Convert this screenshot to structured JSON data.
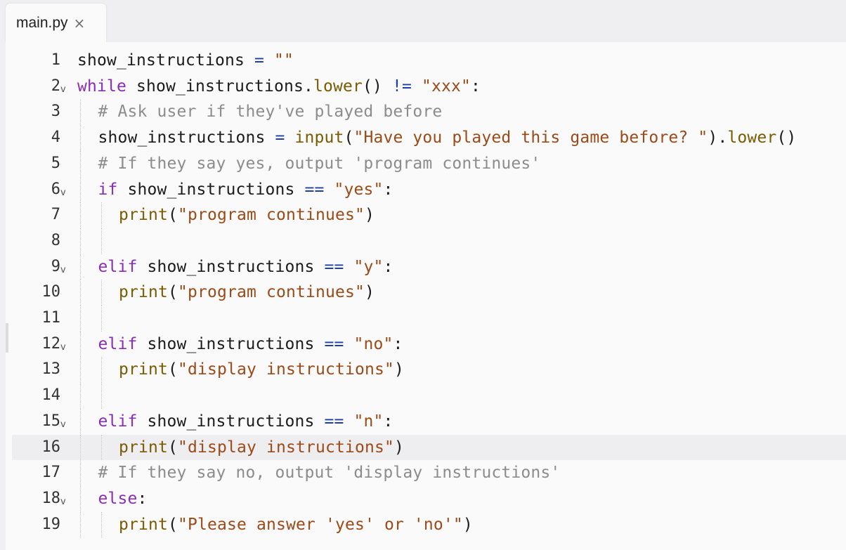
{
  "tab": {
    "filename": "main.py",
    "close_icon": "×"
  },
  "fold_glyph": "v",
  "active_line": 16,
  "lines": [
    {
      "n": "1",
      "fold": false,
      "indent": 0,
      "tokens": [
        [
          "t",
          "show_instructions"
        ],
        [
          "t",
          " "
        ],
        [
          "op",
          "="
        ],
        [
          "t",
          " "
        ],
        [
          "str",
          "\"\""
        ]
      ]
    },
    {
      "n": "2",
      "fold": true,
      "indent": 0,
      "tokens": [
        [
          "kw",
          "while"
        ],
        [
          "t",
          " show_instructions."
        ],
        [
          "fn",
          "lower"
        ],
        [
          "t",
          "() "
        ],
        [
          "op",
          "!="
        ],
        [
          "t",
          " "
        ],
        [
          "str",
          "\"xxx\""
        ],
        [
          "t",
          ":"
        ]
      ]
    },
    {
      "n": "3",
      "fold": false,
      "indent": 1,
      "tokens": [
        [
          "cmt",
          "# Ask user if they've played before"
        ]
      ]
    },
    {
      "n": "4",
      "fold": false,
      "indent": 1,
      "tokens": [
        [
          "t",
          "show_instructions "
        ],
        [
          "op",
          "="
        ],
        [
          "t",
          " "
        ],
        [
          "fn",
          "input"
        ],
        [
          "t",
          "("
        ],
        [
          "str",
          "\"Have you played this game before? \""
        ],
        [
          "t",
          ")."
        ],
        [
          "fn",
          "lower"
        ],
        [
          "t",
          "()"
        ]
      ]
    },
    {
      "n": "5",
      "fold": false,
      "indent": 1,
      "tokens": [
        [
          "cmt",
          "# If they say yes, output 'program continues'"
        ]
      ]
    },
    {
      "n": "6",
      "fold": true,
      "indent": 1,
      "tokens": [
        [
          "kw",
          "if"
        ],
        [
          "t",
          " show_instructions "
        ],
        [
          "op",
          "=="
        ],
        [
          "t",
          " "
        ],
        [
          "str",
          "\"yes\""
        ],
        [
          "t",
          ":"
        ]
      ]
    },
    {
      "n": "7",
      "fold": false,
      "indent": 2,
      "tokens": [
        [
          "fn",
          "print"
        ],
        [
          "t",
          "("
        ],
        [
          "str",
          "\"program continues\""
        ],
        [
          "t",
          ")"
        ]
      ]
    },
    {
      "n": "8",
      "fold": false,
      "indent": 2,
      "tokens": []
    },
    {
      "n": "9",
      "fold": true,
      "indent": 1,
      "tokens": [
        [
          "kw",
          "elif"
        ],
        [
          "t",
          " show_instructions "
        ],
        [
          "op",
          "=="
        ],
        [
          "t",
          " "
        ],
        [
          "str",
          "\"y\""
        ],
        [
          "t",
          ":"
        ]
      ]
    },
    {
      "n": "10",
      "fold": false,
      "indent": 2,
      "tokens": [
        [
          "fn",
          "print"
        ],
        [
          "t",
          "("
        ],
        [
          "str",
          "\"program continues\""
        ],
        [
          "t",
          ")"
        ]
      ]
    },
    {
      "n": "11",
      "fold": false,
      "indent": 2,
      "tokens": []
    },
    {
      "n": "12",
      "fold": true,
      "indent": 1,
      "tokens": [
        [
          "kw",
          "elif"
        ],
        [
          "t",
          " show_instructions "
        ],
        [
          "op",
          "=="
        ],
        [
          "t",
          " "
        ],
        [
          "str",
          "\"no\""
        ],
        [
          "t",
          ":"
        ]
      ]
    },
    {
      "n": "13",
      "fold": false,
      "indent": 2,
      "tokens": [
        [
          "fn",
          "print"
        ],
        [
          "t",
          "("
        ],
        [
          "str",
          "\"display instructions\""
        ],
        [
          "t",
          ")"
        ]
      ]
    },
    {
      "n": "14",
      "fold": false,
      "indent": 2,
      "tokens": []
    },
    {
      "n": "15",
      "fold": true,
      "indent": 1,
      "tokens": [
        [
          "kw",
          "elif"
        ],
        [
          "t",
          " show_instructions "
        ],
        [
          "op",
          "=="
        ],
        [
          "t",
          " "
        ],
        [
          "str",
          "\"n\""
        ],
        [
          "t",
          ":"
        ]
      ]
    },
    {
      "n": "16",
      "fold": false,
      "indent": 2,
      "tokens": [
        [
          "fn",
          "print"
        ],
        [
          "t",
          "("
        ],
        [
          "str",
          "\"display instructions\""
        ],
        [
          "t",
          ")"
        ]
      ]
    },
    {
      "n": "17",
      "fold": false,
      "indent": 1,
      "tokens": [
        [
          "cmt",
          "# If they say no, output 'display instructions'"
        ]
      ]
    },
    {
      "n": "18",
      "fold": true,
      "indent": 1,
      "tokens": [
        [
          "kw",
          "else"
        ],
        [
          "t",
          ":"
        ]
      ]
    },
    {
      "n": "19",
      "fold": false,
      "indent": 2,
      "tokens": [
        [
          "fn",
          "print"
        ],
        [
          "t",
          "("
        ],
        [
          "str",
          "\"Please answer 'yes' or 'no'\""
        ],
        [
          "t",
          ")"
        ]
      ]
    }
  ],
  "colors": {
    "keyword": "#8a2eb8",
    "operator": "#1f3fa8",
    "string": "#9c4a17",
    "function": "#7b5a00",
    "comment": "#8c8c8c",
    "active_line_bg": "#eeeef0"
  }
}
